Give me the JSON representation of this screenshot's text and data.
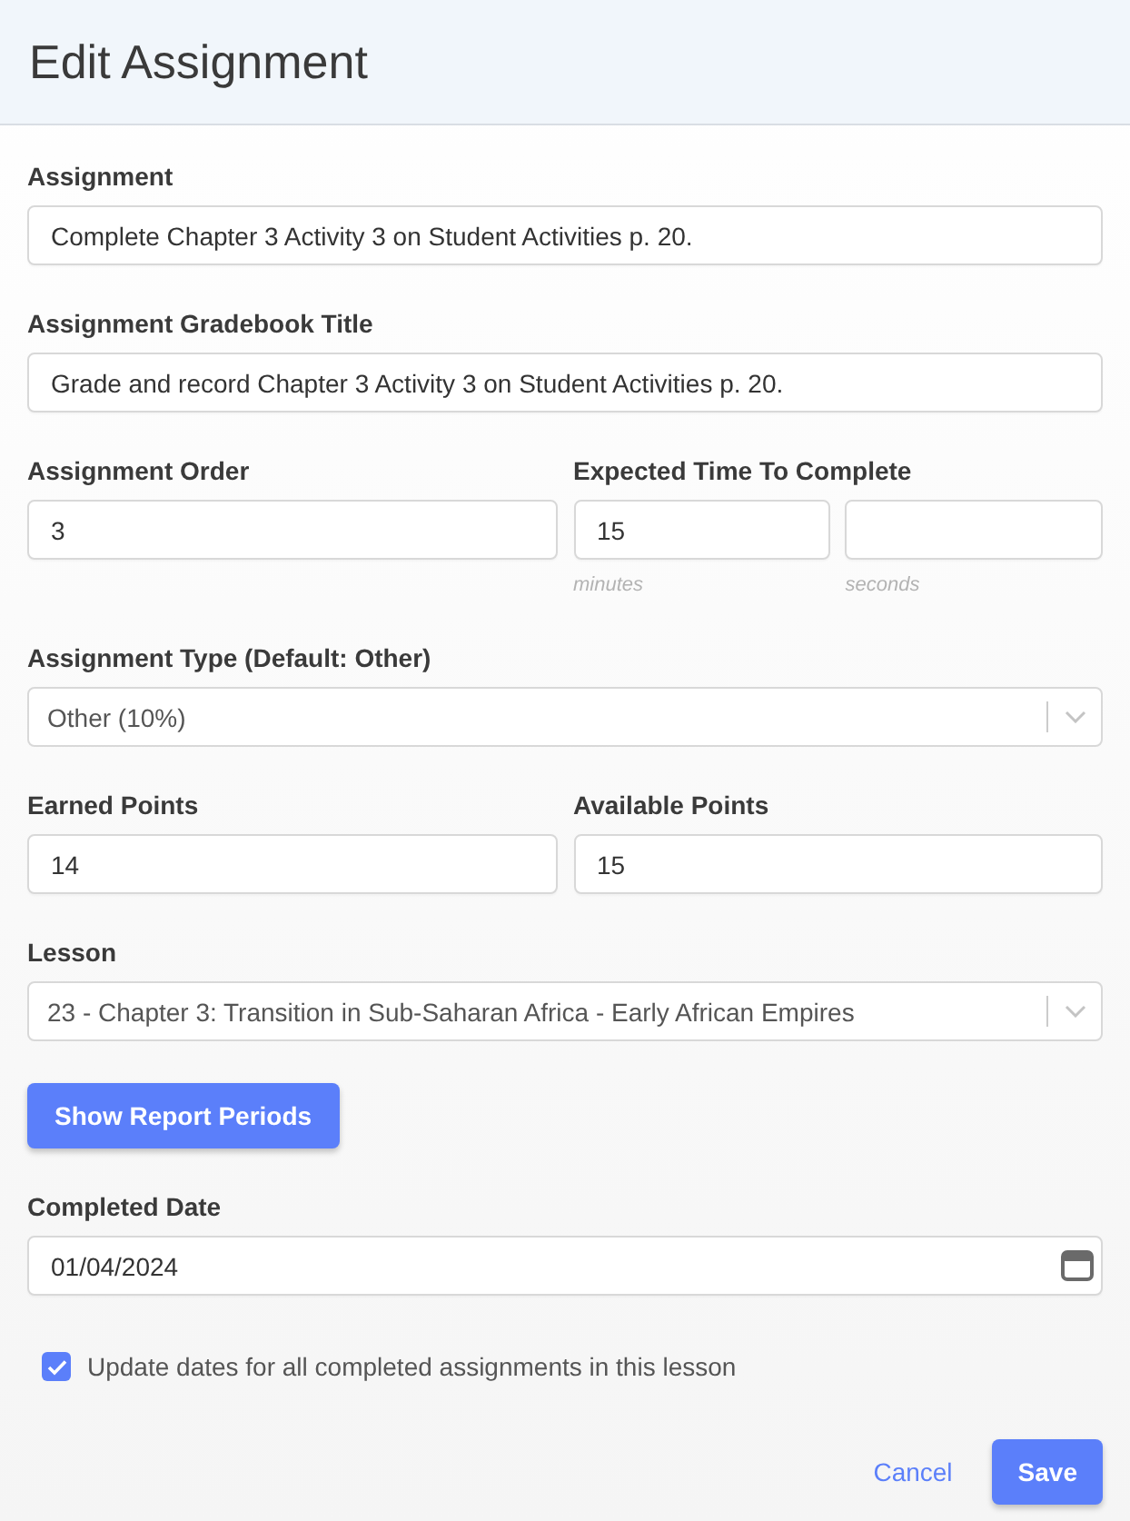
{
  "dialog": {
    "title": "Edit Assignment"
  },
  "fields": [
    {
      "kind": "text",
      "label": "Assignment",
      "value": "Complete Chapter 3 Activity 3 on Student Activities p. 20."
    },
    {
      "kind": "text",
      "label": "Assignment Gradebook Title",
      "value": "Grade and record Chapter 3 Activity 3 on Student Activities p. 20."
    },
    {
      "kind": "pair",
      "columns": [
        {
          "kind": "text",
          "label": "Assignment Order",
          "value": "3"
        },
        {
          "kind": "split",
          "label": "Expected Time To Complete",
          "inputs": [
            {
              "value": "15",
              "hint": "minutes"
            },
            {
              "hint": "seconds"
            }
          ]
        }
      ]
    },
    {
      "kind": "select",
      "label": "Assignment Type (Default: Other)",
      "value": "Other (10%)"
    },
    {
      "kind": "pair",
      "columns": [
        {
          "kind": "text",
          "label": "Earned Points",
          "value": "14"
        },
        {
          "kind": "text",
          "label": "Available Points",
          "value": "15"
        }
      ]
    },
    {
      "kind": "select",
      "label": "Lesson",
      "value": "23 - Chapter 3: Transition in Sub-Saharan Africa - Early African Empires"
    },
    {
      "kind": "button",
      "label": "Show Report Periods"
    },
    {
      "kind": "date",
      "label": "Completed Date",
      "value": "01/04/2024"
    },
    {
      "kind": "checkbox",
      "label": "Update dates for all completed assignments in this lesson",
      "checked": true
    }
  ],
  "actions": [
    {
      "kind": "link",
      "label": "Cancel"
    },
    {
      "kind": "primary",
      "label": "Save"
    }
  ]
}
